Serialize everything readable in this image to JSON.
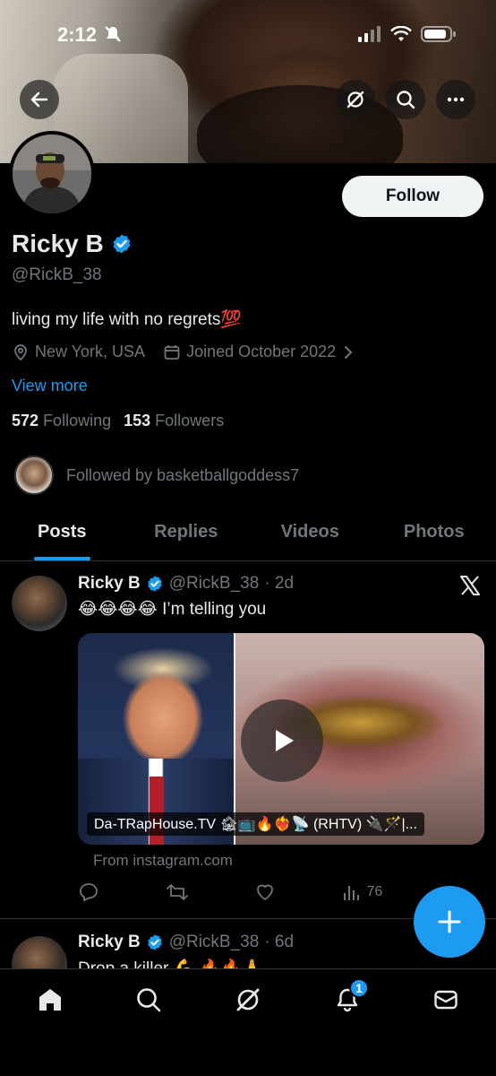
{
  "status_bar": {
    "time": "2:12"
  },
  "header": {
    "back_icon": "arrow-left-icon",
    "grok_icon": "grok-icon",
    "search_icon": "search-icon",
    "more_icon": "more-horizontal-icon"
  },
  "profile": {
    "follow_label": "Follow",
    "name": "Ricky B",
    "verified": true,
    "handle": "@RickB_38",
    "bio": "living my life with no regrets💯",
    "location": "New York, USA",
    "joined": "Joined October 2022",
    "view_more": "View more",
    "following_count": "572",
    "following_label": "Following",
    "followers_count": "153",
    "followers_label": "Followers",
    "followed_by": "Followed by basketballgoddess7"
  },
  "tabs": [
    {
      "label": "Posts",
      "active": true
    },
    {
      "label": "Replies",
      "active": false
    },
    {
      "label": "Videos",
      "active": false
    },
    {
      "label": "Photos",
      "active": false
    }
  ],
  "posts": [
    {
      "name": "Ricky B",
      "handle": "@RickB_38",
      "time": "· 2d",
      "text": "😂😂😂😂 I’m telling you",
      "media_caption": "Da-TRapHouse.TV 🏚📺🔥❤️‍🔥📡 (RHTV) 🔌🪄|...",
      "source": "From instagram.com",
      "views": "76"
    },
    {
      "name": "Ricky B",
      "handle": "@RickB_38",
      "time": "· 6d",
      "text": "Drop a killer 💪 🔥🔥🙏"
    }
  ],
  "bottom_nav": {
    "notifications_badge": "1"
  },
  "colors": {
    "accent": "#1d9bf0",
    "background": "#000000",
    "muted": "#71767b",
    "text": "#e7e9ea"
  }
}
